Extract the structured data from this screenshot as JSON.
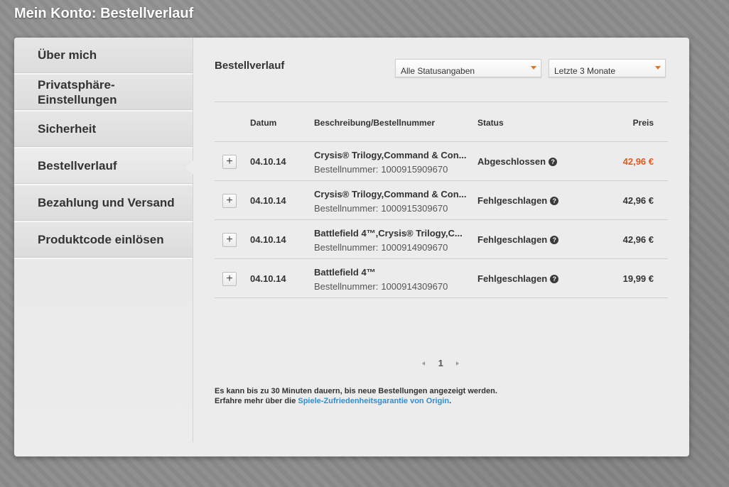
{
  "page": {
    "title": "Mein Konto: Bestellverlauf"
  },
  "colors": {
    "accent": "#e8741a",
    "link": "#2f8fce",
    "highlight_price": "#e05a1c"
  },
  "sidebar": {
    "items": [
      {
        "label": "Über mich"
      },
      {
        "label_line1": "Privatsphäre-",
        "label_line2": "Einstellungen"
      },
      {
        "label": "Sicherheit"
      },
      {
        "label": "Bestellverlauf",
        "active": true
      },
      {
        "label": "Bezahlung und Versand"
      },
      {
        "label": "Produktcode einlösen"
      }
    ]
  },
  "main": {
    "title": "Bestellverlauf",
    "filters": {
      "status": {
        "selected": "Alle Statusangaben",
        "icon": "chevron-down-icon"
      },
      "period": {
        "selected": "Letzte 3 Monate",
        "icon": "chevron-down-icon"
      }
    },
    "table": {
      "headers": {
        "date": "Datum",
        "description": "Beschreibung/Bestellnummer",
        "status": "Status",
        "price": "Preis"
      },
      "order_number_label": "Bestellnummer:",
      "rows": [
        {
          "expand": "+",
          "date": "04.10.14",
          "title": "Crysis® Trilogy,Command & Con...",
          "order_number": "1000915909670",
          "status": "Abgeschlossen",
          "help": "?",
          "price": "42,96 €",
          "highlight": true
        },
        {
          "expand": "+",
          "date": "04.10.14",
          "title": "Crysis® Trilogy,Command & Con...",
          "order_number": "1000915309670",
          "status": "Fehlgeschlagen",
          "help": "?",
          "price": "42,96 €",
          "highlight": false
        },
        {
          "expand": "+",
          "date": "04.10.14",
          "title": "Battlefield 4™,Crysis® Trilogy,C...",
          "order_number": "1000914909670",
          "status": "Fehlgeschlagen",
          "help": "?",
          "price": "42,96 €",
          "highlight": false
        },
        {
          "expand": "+",
          "date": "04.10.14",
          "title": "Battlefield 4™",
          "order_number": "1000914309670",
          "status": "Fehlgeschlagen",
          "help": "?",
          "price": "19,99 €",
          "highlight": false
        }
      ]
    },
    "pagination": {
      "current_page": "1"
    },
    "notice": {
      "line1": "Es kann bis zu 30 Minuten dauern, bis neue Bestellungen angezeigt werden.",
      "line2_prefix": "Erfahre mehr über die ",
      "link_text": "Spiele-Zufriedenheitsgarantie von Origin",
      "line2_suffix": "."
    }
  }
}
